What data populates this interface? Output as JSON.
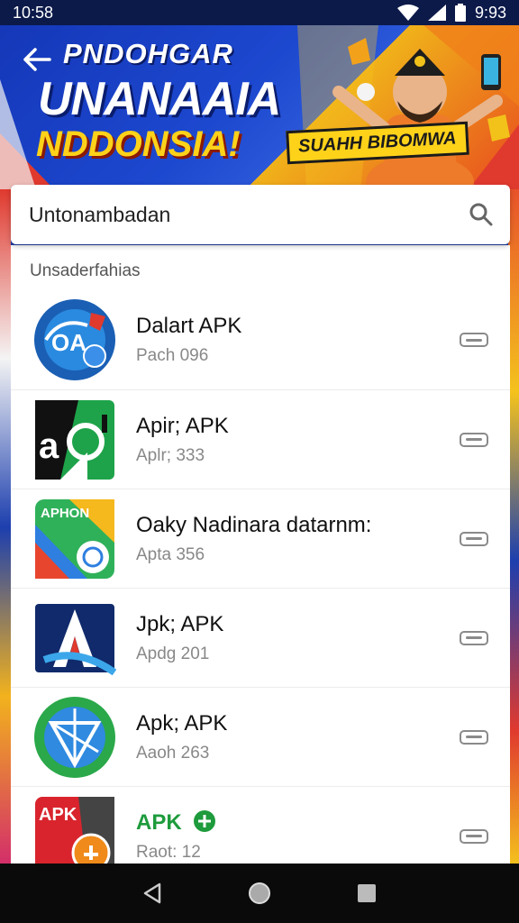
{
  "status": {
    "time": "10:58",
    "right_time": "9:93"
  },
  "banner": {
    "title": "PNDOHGAR",
    "headline": "UNANAAIA",
    "sub": "NDDONSIA!",
    "badge": "SUAHH BIBOMWA"
  },
  "search": {
    "value": "Untonambadan"
  },
  "list": {
    "section_label": "Unsaderfahias",
    "items": [
      {
        "title": "Dalart APK",
        "subtitle": "Pach 096",
        "icon": "dalart-app-icon"
      },
      {
        "title": "Apir; APK",
        "subtitle": "Aplr; 333",
        "icon": "apir-app-icon"
      },
      {
        "title": "Oaky Nadinara datarnm:",
        "subtitle": "Apta 356",
        "icon": "aphon-app-icon"
      },
      {
        "title": "Jpk; APK",
        "subtitle": "Apdg 201",
        "icon": "jpk-app-icon"
      },
      {
        "title": "Apk; APK",
        "subtitle": "Aaoh 263",
        "icon": "apk-globe-app-icon"
      },
      {
        "title": "APK",
        "subtitle": "Raot: 12",
        "icon": "apk-red-app-icon"
      }
    ]
  },
  "nav": {
    "back": "back-icon",
    "home": "home-icon",
    "recents": "recents-icon"
  }
}
